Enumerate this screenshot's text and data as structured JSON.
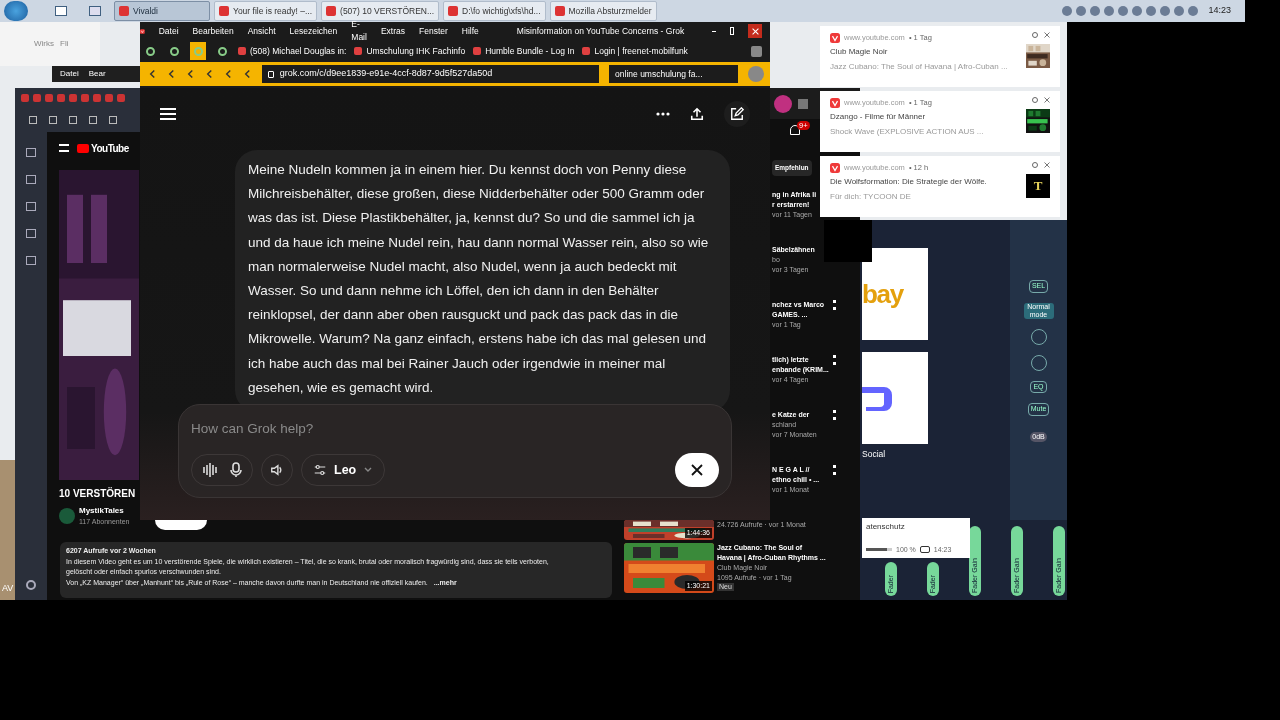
{
  "taskbar": {
    "buttons": [
      {
        "label": "Vivaldi",
        "selected": true
      },
      {
        "label": "Your file is ready! –...",
        "selected": false
      },
      {
        "label": "(507) 10 VERSTÖREN...",
        "selected": false
      },
      {
        "label": "D:\\fo wichtig\\xfs\\hd...",
        "selected": false
      },
      {
        "label": "Mozilla Absturzmelder",
        "selected": false
      }
    ],
    "clock": "14:23"
  },
  "back_window": {
    "tabs": [
      "Wirks",
      "Fli"
    ],
    "menu": [
      "Datei",
      "Bear"
    ]
  },
  "browser": {
    "menu": [
      "Datei",
      "Bearbeiten",
      "Ansicht",
      "Lesezeichen",
      "E-Mail",
      "Extras",
      "Fenster",
      "Hilfe"
    ],
    "title": "Misinformation on YouTube Concerns - Grok",
    "icon_tabs": [
      {
        "selected": false
      },
      {
        "selected": false
      },
      {
        "selected": true
      },
      {
        "selected": false
      }
    ],
    "tabs": [
      {
        "label": "(508) Michael Douglas in:",
        "selected": false
      },
      {
        "label": "Umschulung IHK Fachinfo",
        "selected": false
      },
      {
        "label": "Humble Bundle - Log In",
        "selected": false
      },
      {
        "label": "Login | freenet-mobilfunk",
        "selected": false
      }
    ],
    "address": "grok.com/c/d9ee1839-e91e-4ccf-8d87-9d5f527da50d",
    "search": "online umschulung fa..."
  },
  "grok": {
    "message": " Meine Nudeln kommen ja in einem hier. Du kennst doch von Penny diese Milchreisbehälter, diese großen, diese Nidderbehälter oder 500 Gramm oder was das ist. Diese Plastikbehälter, ja, kennst du? So und die sammel ich ja und da haue ich meine Nudel rein, hau dann normal Wasser rein, also so wie man normalerweise Nudel macht, also Nudel, wenn ja auch bedeckt mit Wasser. So und dann nehme ich Löffel, den ich dann in den Behälter reinklopsel, der dann aber oben rausguckt und pack das pack das in die Mikrowelle. Warum? Na ganz einfach, erstens habe ich das mal gelesen und ich habe auch das mal bei Rainer Jauch oder irgendwie in meiner mal gesehen, wie es gemacht wird.",
    "input": {
      "placeholder": "How can Grok help?"
    },
    "voice": "Leo"
  },
  "side_browser": {
    "logo": "YouTube",
    "video_title": "10 VERSTÖREN",
    "channel": "MystikTales",
    "subscribers": "117 Abonnenten"
  },
  "description": {
    "meta": "6207 Aufrufe  vor 2 Wochen",
    "lines": [
      "In diesem Video geht es um 10 verstörende Spiele, die wirklich existieren – Titel, die so krank, brutal oder moralisch fragwürdig sind, dass sie teils verboten,",
      "gelöscht oder einfach spurlos verschwunden sind.",
      "Von „KZ Manager“ über „Manhunt“ bis „Rule of Rose“ – manche davon durfte man in Deutschland nie offiziell kaufen."
    ],
    "more": "...mehr"
  },
  "recommendations": {
    "bell_count": "9+",
    "chip": "Empfehlun",
    "items": [
      {
        "lines": [
          "ng in Afrika li",
          "r erstarren!"
        ],
        "meta": "vor 11 Tagen"
      },
      {
        "lines": [
          "Säbelzähnen"
        ],
        "sub": "bo",
        "meta": "vor 3 Tagen"
      },
      {
        "lines": [
          "nchez vs Marco",
          "GAMES. ..."
        ],
        "meta": "vor 1 Tag"
      },
      {
        "lines": [
          "tlich) letzte",
          "enbande (KRIM..."
        ],
        "meta": "vor 4 Tagen"
      },
      {
        "lines": [
          "e Katze der"
        ],
        "sub": "schland",
        "meta": "vor 7 Monaten"
      },
      {
        "lines": [
          "N E G A L //",
          "ethno chill • ..."
        ],
        "meta": "vor 1 Monat"
      }
    ],
    "videos": [
      {
        "duration": "1:44:36",
        "lines": [
          "24.726 Aufrufe · vor 1 Monat"
        ]
      },
      {
        "duration": "1:30:21",
        "lines": [
          "Jazz Cubano: The Soul of",
          "Havana | Afro-Cuban Rhythms ...",
          "Club Magie Noir",
          "1095 Aufrufe · vor 1 Tag"
        ],
        "badge": "Neu"
      }
    ]
  },
  "notifications": [
    {
      "site": "www.youtube.com",
      "age": "• 1 Tag",
      "title": "Club Magie Noir",
      "body": "Jazz Cubano: The Soul of Havana | Afro-Cuban ..."
    },
    {
      "site": "www.youtube.com",
      "age": "• 1 Tag",
      "title": "Dzango - Filme für Männer",
      "body": "Shock Wave (EXPLOSIVE ACTION AUS ..."
    },
    {
      "site": "www.youtube.com",
      "age": "• 12 h",
      "title": "Die Wolfsformation: Die Strategie der Wölfe.",
      "body": "Für dich: TYCOON DE",
      "thumb_letter": "T"
    }
  ],
  "tiles": {
    "logo": "bay",
    "label": "Social"
  },
  "dialog": {
    "label": "atenschutz",
    "zoom": "100 %",
    "time": "14:23",
    "level": 0.8
  },
  "mixer": {
    "buttons": [
      "SEL",
      "Normal mode",
      "EQ",
      "Mute"
    ],
    "level_label": "0dB",
    "faders": [
      {
        "label": "Fader",
        "kind": "short"
      },
      {
        "label": "Fader",
        "kind": "short"
      },
      {
        "label": "Fader Gain",
        "kind": "tall"
      },
      {
        "label": "Fader Gain",
        "kind": "tall"
      },
      {
        "label": "Fader Gain",
        "kind": "tall"
      }
    ]
  },
  "desktop_icon": "AV"
}
